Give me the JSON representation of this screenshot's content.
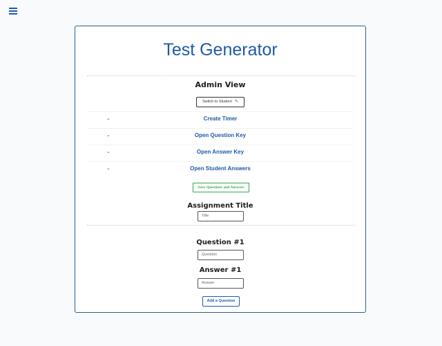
{
  "menu": {
    "icon": "hamburger-menu-icon"
  },
  "header": {
    "title": "Test Generator"
  },
  "admin": {
    "heading": "Admin View",
    "switch_label": "Switch to Student",
    "switch_icon": "pencil-icon"
  },
  "accordion": {
    "items": [
      {
        "label": "Create Timer",
        "icon": "chevron-down-icon"
      },
      {
        "label": "Open Question Key",
        "icon": "chevron-down-icon"
      },
      {
        "label": "Open Answer Key",
        "icon": "chevron-down-icon"
      },
      {
        "label": "Open Student Answers",
        "icon": "chevron-down-icon"
      }
    ]
  },
  "save": {
    "label": "Save Questions and Answers"
  },
  "assignment": {
    "title_label": "Assignment Title",
    "title_placeholder": "Title"
  },
  "question": {
    "label": "Question #1",
    "placeholder": "Question",
    "answer_label": "Answer #1",
    "answer_placeholder": "Answer"
  },
  "add": {
    "label": "Add a Question"
  },
  "colors": {
    "accent": "#1f5aa6",
    "save_green": "#2fa84f",
    "card_border": "#2c5f8a"
  }
}
